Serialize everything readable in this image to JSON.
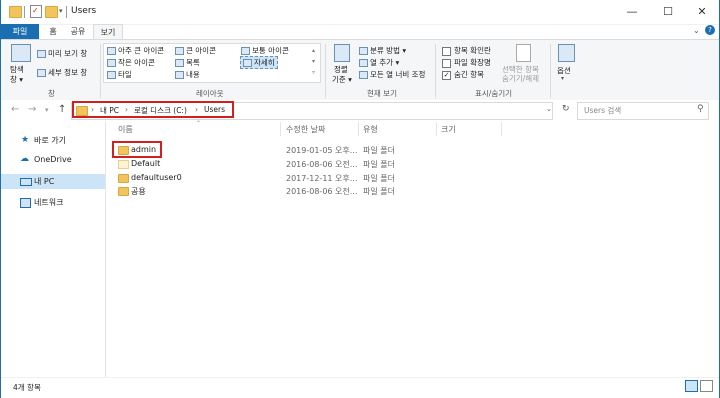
{
  "window": {
    "title": "Users",
    "minimize_glyph": "—",
    "maximize_glyph": "☐",
    "close_glyph": "✕",
    "help_glyph": "?",
    "collapse_glyph": "⌄"
  },
  "ribbon_tabs": [
    "파일",
    "홈",
    "공유",
    "보기"
  ],
  "ribbon": {
    "pane_group": {
      "nav_pane_label": "탐색\n창 ▾",
      "nav1": "탐색",
      "nav2": "창 ▾",
      "preview": "미리 보기 창",
      "details": "세부 정보 창",
      "group_label": "창"
    },
    "layout_group": {
      "col1": [
        "아주 큰 아이콘",
        "작은 아이콘",
        "타일"
      ],
      "col2": [
        "큰 아이콘",
        "목록",
        "내용"
      ],
      "col3": [
        "보통 아이콘",
        "자세히"
      ],
      "group_label": "레이아웃"
    },
    "view_group": {
      "sort_label1": "정렬",
      "sort_label2": "기준 ▾",
      "items": [
        "분류 방법 ▾",
        "열 추가 ▾",
        "모든 열 너비 조정"
      ],
      "group_label": "현재 보기"
    },
    "showhide_group": {
      "checks": [
        "항목 확인란",
        "파일 확장명",
        "숨긴 항목"
      ],
      "hide_sel1": "선택한 항목",
      "hide_sel2": "숨기기/해제",
      "group_label": "표시/숨기기"
    },
    "options_label": "옵션"
  },
  "address": {
    "crumbs": [
      "내 PC",
      "로컬 디스크 (C:)",
      "Users"
    ],
    "search_placeholder": "Users 검색"
  },
  "nav_pane": {
    "items": [
      "바로 가기",
      "OneDrive",
      "내 PC",
      "네트워크"
    ]
  },
  "columns": [
    "이름",
    "수정한 날짜",
    "유형",
    "크기"
  ],
  "files": [
    {
      "name": "admin",
      "date": "2019-01-05 오후...",
      "type": "파일 폴더"
    },
    {
      "name": "Default",
      "date": "2016-08-06 오전...",
      "type": "파일 폴더"
    },
    {
      "name": "defaultuser0",
      "date": "2017-12-11 오후...",
      "type": "파일 폴더"
    },
    {
      "name": "공용",
      "date": "2016-08-06 오전...",
      "type": "파일 폴더"
    }
  ],
  "status": {
    "count": "4개 항목"
  },
  "colors": {
    "accent": "#1b6fb0",
    "highlight": "#d21f1f",
    "selection": "#cce4f7",
    "folder": "#f2c55c"
  }
}
